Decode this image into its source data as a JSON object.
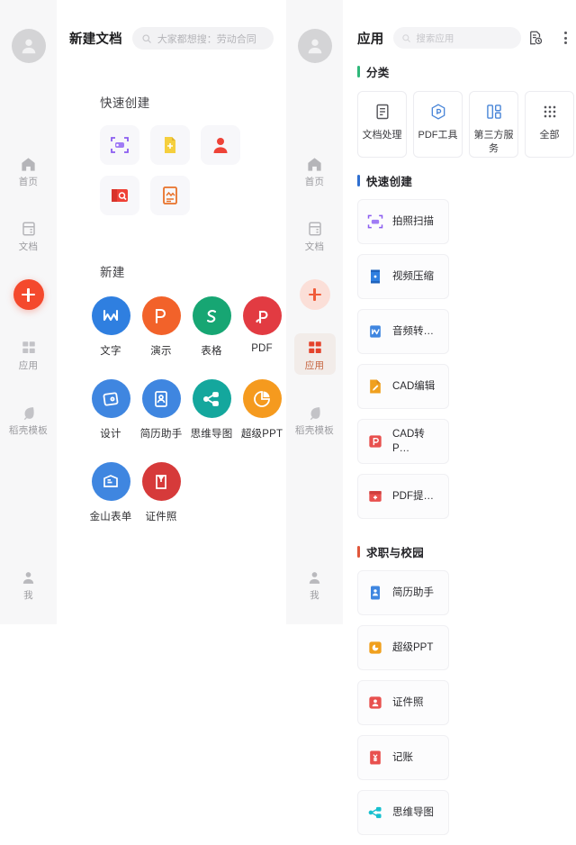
{
  "left_rail": {
    "avatar_name": "user-avatar",
    "items": [
      {
        "label": "首页",
        "icon": "home-icon",
        "active": false
      },
      {
        "label": "文档",
        "icon": "document-icon",
        "active": false
      },
      {
        "label": "应用",
        "icon": "apps-grid-icon",
        "active": false
      },
      {
        "label": "稻壳模板",
        "icon": "template-leaf-icon",
        "active": false
      }
    ],
    "plus_label": "+",
    "bottom": {
      "label": "我",
      "icon": "person-icon"
    }
  },
  "mid_rail": {
    "avatar_name": "user-avatar",
    "items": [
      {
        "label": "首页",
        "icon": "home-icon",
        "active": false
      },
      {
        "label": "文档",
        "icon": "document-icon",
        "active": false
      },
      {
        "label": "应用",
        "icon": "apps-grid-icon",
        "active": true
      },
      {
        "label": "稻壳模板",
        "icon": "template-leaf-icon",
        "active": false
      }
    ],
    "plus_label": "+",
    "bottom": {
      "label": "我",
      "icon": "person-icon"
    }
  },
  "doc_panel": {
    "title": "新建文档",
    "search_placeholder": "大家都想搜：劳动合同",
    "quick_create_title": "快速创建",
    "quick_create": [
      {
        "name": "scan-photo-icon",
        "color": "#8a5cf0"
      },
      {
        "name": "new-doc-icon",
        "color": "#f4c430"
      },
      {
        "name": "id-photo-person-icon",
        "color": "#ef4136"
      },
      {
        "name": "pdf-scan-icon",
        "color": "#ef4136"
      },
      {
        "name": "image-to-text-icon",
        "color": "#e8722a"
      }
    ],
    "new_title": "新建",
    "new_items": [
      {
        "label": "文字",
        "glyph": "W",
        "color": "#2f7fe0"
      },
      {
        "label": "演示",
        "glyph": "P",
        "color": "#f2622a"
      },
      {
        "label": "表格",
        "glyph": "S",
        "color": "#17a673"
      },
      {
        "label": "PDF",
        "glyph": "P",
        "color": "#e23b42"
      },
      {
        "label": "设计",
        "glyph": "D",
        "color": "#3f86e0"
      },
      {
        "label": "简历助手",
        "glyph": "R",
        "color": "#3f86e0"
      },
      {
        "label": "思维导图",
        "glyph": "M",
        "color": "#14a79d"
      },
      {
        "label": "超级PPT",
        "glyph": "C",
        "color": "#f59a1e"
      },
      {
        "label": "金山表单",
        "glyph": "F",
        "color": "#3f86e0"
      },
      {
        "label": "证件照",
        "glyph": "I",
        "color": "#d63a3a"
      }
    ]
  },
  "apps_panel": {
    "title": "应用",
    "search_placeholder": "搜索应用",
    "history_icon": "recent-document-icon",
    "menu_icon": "more-kebab-icon",
    "sections": [
      {
        "title": "分类",
        "accent": "#2fb87a",
        "type": "category",
        "cards": [
          {
            "label": "文档处理",
            "icon": "doc-lines-icon",
            "color": "#5a5a5e"
          },
          {
            "label": "PDF工具",
            "icon": "pdf-hex-icon",
            "color": "#3f86e0"
          },
          {
            "label": "第三方服务",
            "icon": "third-party-icon",
            "color": "#3f86e0"
          },
          {
            "label": "全部",
            "icon": "grid-dots-icon",
            "color": "#5a5a5e"
          }
        ]
      },
      {
        "title": "快速创建",
        "accent": "#2f6fd0",
        "type": "apps",
        "cards": [
          {
            "label": "拍照扫描",
            "icon": "scan-photo-icon",
            "color": "#8a5cf0",
            "bg": "#f4efff"
          },
          {
            "label": "视频压缩",
            "icon": "video-film-icon",
            "color": "#2f7fe0",
            "bg": "#eaf2fd"
          },
          {
            "label": "音频转…",
            "icon": "audio-to-word-icon",
            "color": "#2f7fe0",
            "bg": "#eaf2fd"
          },
          {
            "label": "CAD编辑",
            "icon": "cad-edit-icon",
            "color": "#f0a01e",
            "bg": "#fdf4e3"
          },
          {
            "label": "CAD转P…",
            "icon": "cad-to-pdf-icon",
            "color": "#e8504e",
            "bg": "#fdecec"
          },
          {
            "label": "PDF提…",
            "icon": "pdf-extract-icon",
            "color": "#e8504e",
            "bg": "#fdecec"
          }
        ]
      },
      {
        "title": "求职与校园",
        "accent": "#e0563a",
        "type": "apps",
        "cards": [
          {
            "label": "简历助手",
            "icon": "resume-card-icon",
            "color": "#3f86e0",
            "bg": "#eaf2fd"
          },
          {
            "label": "超级PPT",
            "icon": "super-ppt-icon",
            "color": "#f0a01e",
            "bg": "#fdf4e3"
          },
          {
            "label": "证件照",
            "icon": "id-photo-icon",
            "color": "#e8504e",
            "bg": "#fdecec"
          },
          {
            "label": "记账",
            "icon": "ledger-icon",
            "color": "#e8504e",
            "bg": "#fdecec"
          },
          {
            "label": "思维导图",
            "icon": "mindmap-icon",
            "color": "#17c0cf",
            "bg": "#e6fbfd"
          }
        ]
      }
    ]
  }
}
